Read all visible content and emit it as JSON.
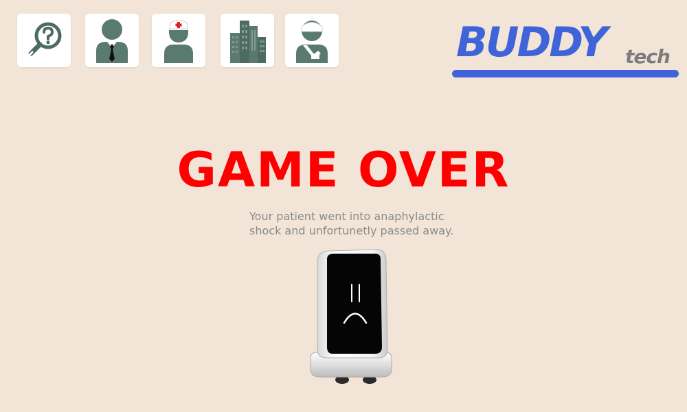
{
  "toolbar": {
    "buttons": [
      {
        "id": "help",
        "icon": "magnifier-question-icon"
      },
      {
        "id": "doctor",
        "icon": "businessman-icon"
      },
      {
        "id": "nurse",
        "icon": "nurse-icon"
      },
      {
        "id": "hospital",
        "icon": "building-icon"
      },
      {
        "id": "patient",
        "icon": "injured-patient-icon"
      }
    ]
  },
  "logo": {
    "main": "BUDDY",
    "sub": "tech",
    "color": "#3f63d9",
    "sub_color": "#7d7d7d"
  },
  "game_over": {
    "title": "GAME OVER",
    "title_color": "#ff0000",
    "message": "Your patient went into anaphylactic\nshock and unfortunetly passed away."
  },
  "robot": {
    "icon": "sad-robot-icon",
    "expression": "sad"
  },
  "colors": {
    "background": "#f2e5d8",
    "icon_fill": "#5b7a6f"
  }
}
